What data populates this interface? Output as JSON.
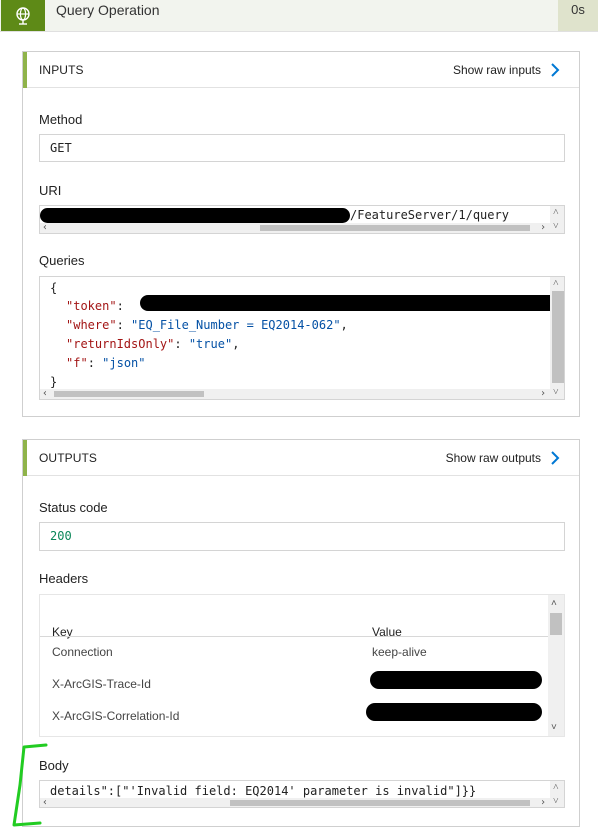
{
  "header": {
    "title": "Query Operation",
    "duration": "0s"
  },
  "inputs": {
    "section_title": "INPUTS",
    "show_raw": "Show raw inputs",
    "method_label": "Method",
    "method_value": "GET",
    "uri_label": "URI",
    "uri_value": "/FeatureServer/1/query",
    "queries_label": "Queries",
    "queries": {
      "open": "{",
      "close": "}",
      "lines": [
        {
          "key": "\"token\"",
          "value": ""
        },
        {
          "key": "\"where\"",
          "value": "\"EQ_File_Number = EQ2014-062\""
        },
        {
          "key": "\"returnIdsOnly\"",
          "value": "\"true\""
        },
        {
          "key": "\"f\"",
          "value": "\"json\""
        }
      ]
    }
  },
  "outputs": {
    "section_title": "OUTPUTS",
    "show_raw": "Show raw outputs",
    "status_label": "Status code",
    "status_value": "200",
    "headers_label": "Headers",
    "headers_columns": [
      "Key",
      "Value"
    ],
    "headers_rows": [
      {
        "key": "Connection",
        "value": "keep-alive"
      },
      {
        "key": "X-ArcGIS-Trace-Id",
        "value": ""
      },
      {
        "key": "X-ArcGIS-Correlation-Id",
        "value": ""
      }
    ],
    "body_label": "Body",
    "body_value": "details\":[\"'Invalid field: EQ2014' parameter is invalid\"]}}"
  },
  "colors": {
    "accent_green": "#5e8a17",
    "section_bar": "#8fb34a",
    "link_blue": "#0078d4",
    "annotation_green": "#22cc22"
  }
}
